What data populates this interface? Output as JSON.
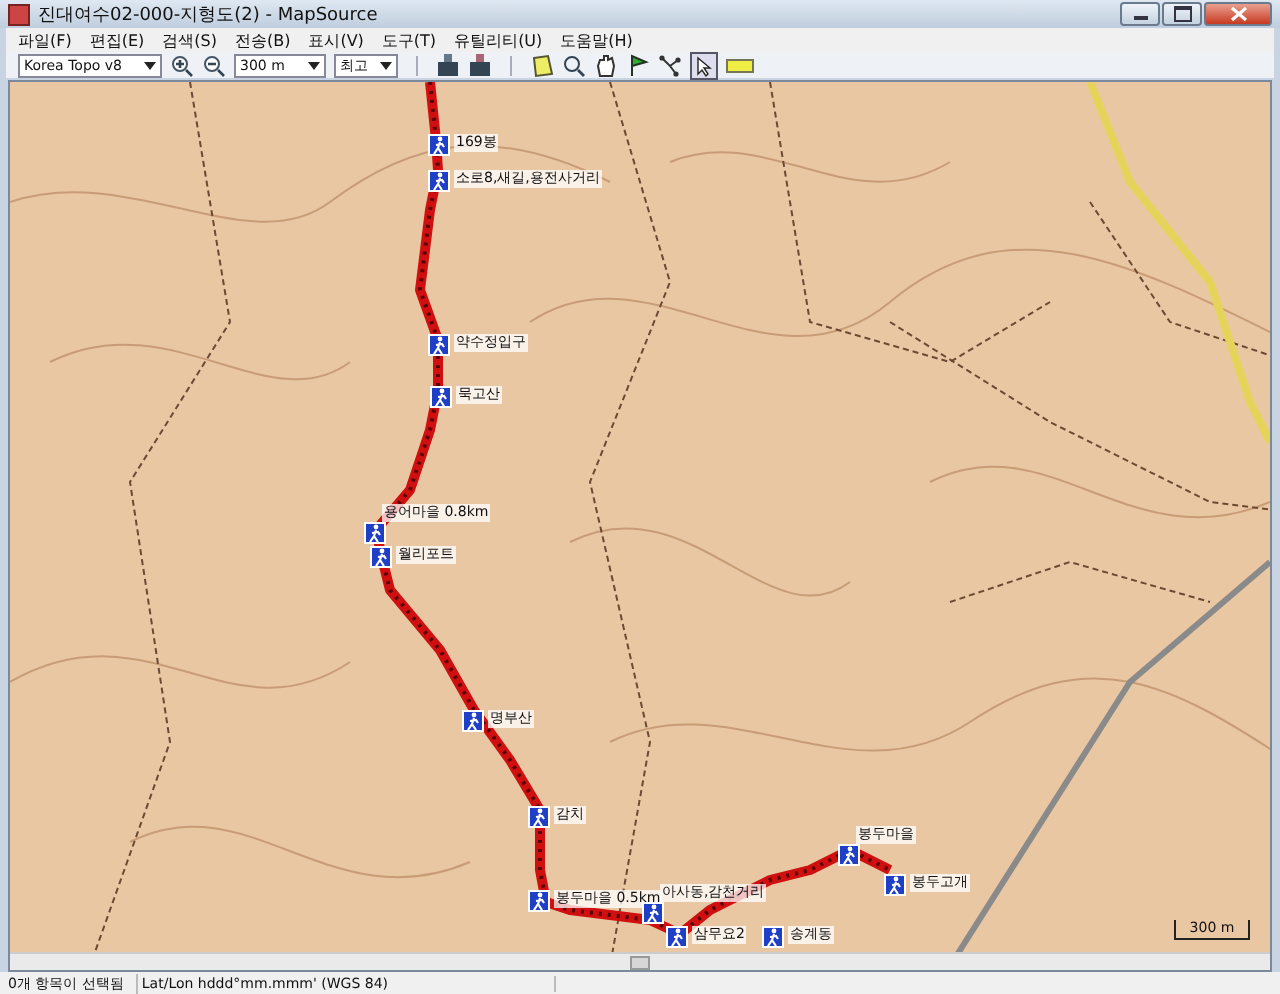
{
  "window": {
    "title": "진대여수02-000-지형도(2) - MapSource"
  },
  "menu": [
    "파일(F)",
    "편집(E)",
    "검색(S)",
    "전송(B)",
    "표시(V)",
    "도구(T)",
    "유틸리티(U)",
    "도움말(H)"
  ],
  "toolbar": {
    "map_product": "Korea Topo v8",
    "zoom_level": "300 m",
    "detail": "최고"
  },
  "map": {
    "waypoints": [
      {
        "label": "169봉"
      },
      {
        "label": "소로8,새길,용전사거리"
      },
      {
        "label": "약수정입구"
      },
      {
        "label": "묵고산"
      },
      {
        "label": "용어마을 0.8km"
      },
      {
        "label": "월리포트"
      },
      {
        "label": "명부산"
      },
      {
        "label": "감치"
      },
      {
        "label": "봉두마을 0.5km"
      },
      {
        "label": "아사동,감천거리"
      },
      {
        "label": "삼무요2"
      },
      {
        "label": "송계동"
      },
      {
        "label": "봉두마을"
      },
      {
        "label": "봉두고개"
      }
    ],
    "scale": "300 m"
  },
  "status_bar": {
    "selection": "0개 항목이 선택됨",
    "coordinates": "Lat/Lon hddd°mm.mmm' (WGS 84)"
  }
}
